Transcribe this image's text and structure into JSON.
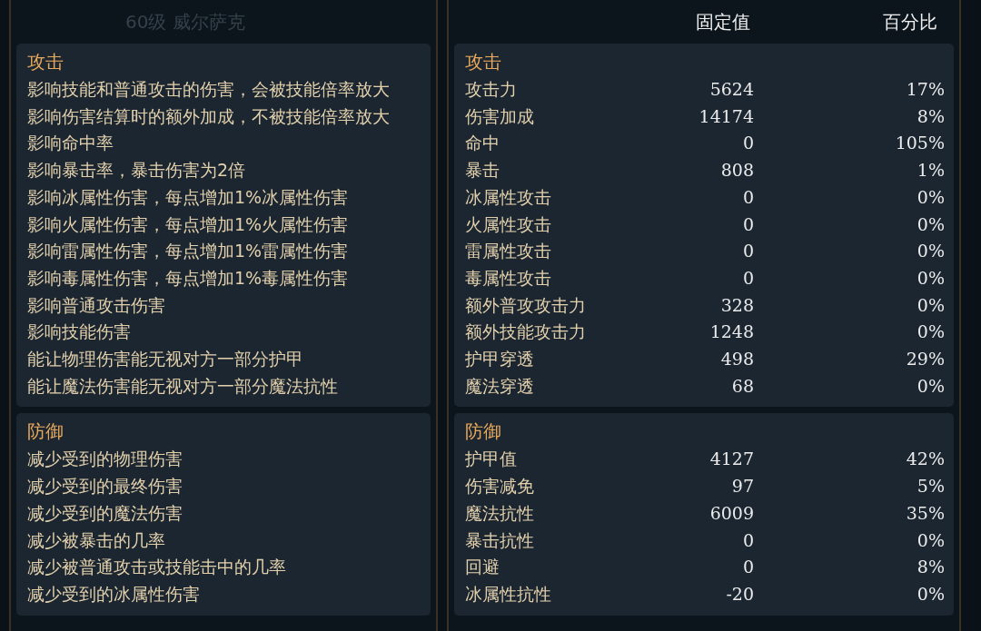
{
  "left_panel": {
    "title": "60级 威尔萨克",
    "sections": [
      {
        "heading": "攻击",
        "rows": [
          "影响技能和普通攻击的伤害，会被技能倍率放大",
          "影响伤害结算时的额外加成，不被技能倍率放大",
          "影响命中率",
          "影响暴击率，暴击伤害为2倍",
          "影响冰属性伤害，每点增加1%冰属性伤害",
          "影响火属性伤害，每点增加1%火属性伤害",
          "影响雷属性伤害，每点增加1%雷属性伤害",
          "影响毒属性伤害，每点增加1%毒属性伤害",
          "影响普通攻击伤害",
          "影响技能伤害",
          "能让物理伤害能无视对方一部分护甲",
          "能让魔法伤害能无视对方一部分魔法抗性"
        ]
      },
      {
        "heading": "防御",
        "rows": [
          "减少受到的物理伤害",
          "减少受到的最终伤害",
          "减少受到的魔法伤害",
          "减少被暴击的几率",
          "减少被普通攻击或技能击中的几率",
          "减少受到的冰属性伤害"
        ]
      }
    ]
  },
  "right_panel": {
    "columns": [
      "固定值",
      "百分比"
    ],
    "sections": [
      {
        "heading": "攻击",
        "rows": [
          {
            "name": "攻击力",
            "fixed": "5624",
            "percent": "17%"
          },
          {
            "name": "伤害加成",
            "fixed": "14174",
            "percent": "8%"
          },
          {
            "name": "命中",
            "fixed": "0",
            "percent": "105%"
          },
          {
            "name": "暴击",
            "fixed": "808",
            "percent": "1%"
          },
          {
            "name": "冰属性攻击",
            "fixed": "0",
            "percent": "0%"
          },
          {
            "name": "火属性攻击",
            "fixed": "0",
            "percent": "0%"
          },
          {
            "name": "雷属性攻击",
            "fixed": "0",
            "percent": "0%"
          },
          {
            "name": "毒属性攻击",
            "fixed": "0",
            "percent": "0%"
          },
          {
            "name": "额外普攻攻击力",
            "fixed": "328",
            "percent": "0%"
          },
          {
            "name": "额外技能攻击力",
            "fixed": "1248",
            "percent": "0%"
          },
          {
            "name": "护甲穿透",
            "fixed": "498",
            "percent": "29%"
          },
          {
            "name": "魔法穿透",
            "fixed": "68",
            "percent": "0%"
          }
        ]
      },
      {
        "heading": "防御",
        "rows": [
          {
            "name": "护甲值",
            "fixed": "4127",
            "percent": "42%"
          },
          {
            "name": "伤害减免",
            "fixed": "97",
            "percent": "5%"
          },
          {
            "name": "魔法抗性",
            "fixed": "6009",
            "percent": "35%"
          },
          {
            "name": "暴击抗性",
            "fixed": "0",
            "percent": "0%"
          },
          {
            "name": "回避",
            "fixed": "0",
            "percent": "8%"
          },
          {
            "name": "冰属性抗性",
            "fixed": "-20",
            "percent": "0%"
          }
        ]
      }
    ]
  }
}
